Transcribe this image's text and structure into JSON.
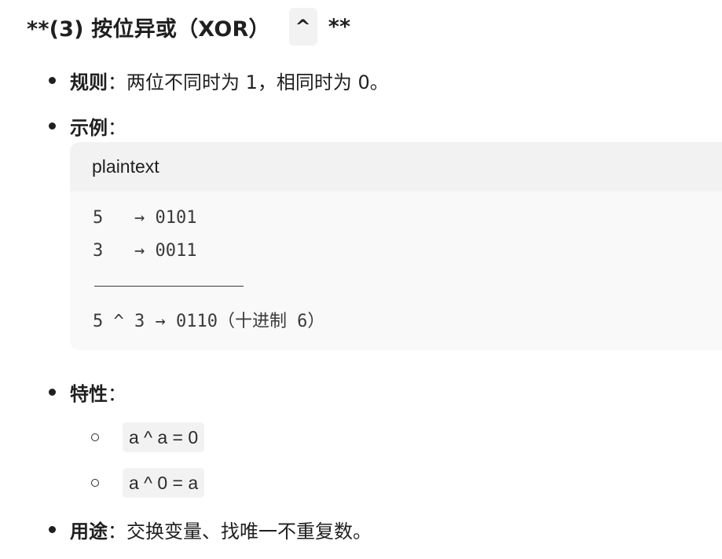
{
  "heading": {
    "prefix": "**(3) 按位异或（XOR）",
    "symbol": "^",
    "suffix": "**"
  },
  "bullets": {
    "rule": {
      "label": "规则",
      "sep": "：",
      "text": "两位不同时为 1，相同时为 0。"
    },
    "example": {
      "label": "示例",
      "sep": "："
    },
    "properties": {
      "label": "特性",
      "sep": "："
    },
    "usage": {
      "label": "用途",
      "sep": "：",
      "text": "交换变量、找唯一不重复数。"
    }
  },
  "code_block": {
    "language": "plaintext",
    "lines": [
      "5   → 0101",
      "3   → 0011",
      "5 ^ 3 → 0110（十进制 6）"
    ]
  },
  "properties_list": [
    "a ^ a = 0",
    "a ^ 0 = a"
  ]
}
